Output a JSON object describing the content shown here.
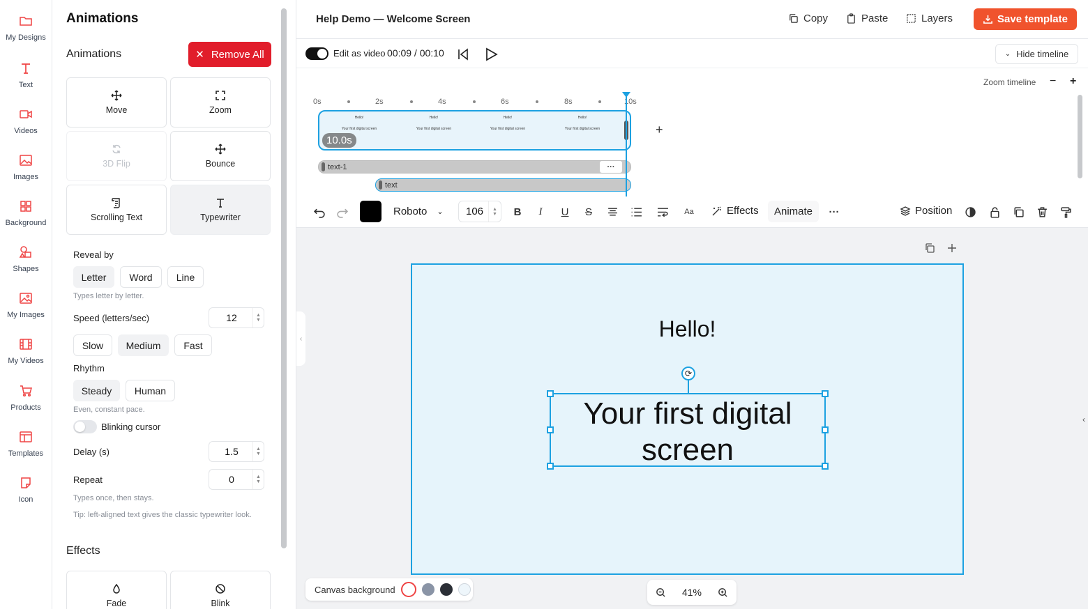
{
  "nav": [
    {
      "label": "My Designs",
      "icon": "folder-icon"
    },
    {
      "label": "Text",
      "icon": "text-icon"
    },
    {
      "label": "Videos",
      "icon": "video-icon"
    },
    {
      "label": "Images",
      "icon": "image-icon"
    },
    {
      "label": "Background",
      "icon": "grid-icon"
    },
    {
      "label": "Shapes",
      "icon": "shapes-icon"
    },
    {
      "label": "My Images",
      "icon": "my-images-icon"
    },
    {
      "label": "My Videos",
      "icon": "film-icon"
    },
    {
      "label": "Products",
      "icon": "cart-icon"
    },
    {
      "label": "Templates",
      "icon": "template-icon"
    },
    {
      "label": "Icon",
      "icon": "sticker-icon"
    }
  ],
  "panel": {
    "title": "Animations",
    "subtitle": "Animations",
    "remove_all": "Remove All",
    "cards": [
      {
        "label": "Move"
      },
      {
        "label": "Zoom"
      },
      {
        "label": "3D Flip"
      },
      {
        "label": "Bounce"
      },
      {
        "label": "Scrolling Text"
      },
      {
        "label": "Typewriter"
      }
    ],
    "reveal_label": "Reveal by",
    "reveal_options": [
      "Letter",
      "Word",
      "Line"
    ],
    "reveal_hint": "Types letter by letter.",
    "speed_label": "Speed (letters/sec)",
    "speed_value": "12",
    "speed_options": [
      "Slow",
      "Medium",
      "Fast"
    ],
    "rhythm_label": "Rhythm",
    "rhythm_options": [
      "Steady",
      "Human"
    ],
    "rhythm_hint": "Even, constant pace.",
    "blinking_label": "Blinking cursor",
    "delay_label": "Delay (s)",
    "delay_value": "1.5",
    "repeat_label": "Repeat",
    "repeat_value": "0",
    "repeat_hint": "Types once, then stays.",
    "tip": "Tip: left-aligned text gives the classic typewriter look.",
    "effects_title": "Effects",
    "effects": [
      {
        "label": "Fade"
      },
      {
        "label": "Blink"
      }
    ]
  },
  "header": {
    "title": "Help Demo — Welcome Screen",
    "copy": "Copy",
    "paste": "Paste",
    "layers": "Layers",
    "save": "Save template"
  },
  "timeline": {
    "edit_as_video": "Edit as video",
    "time": "00:09 / 00:10",
    "hide": "Hide timeline",
    "zoom_label": "Zoom timeline",
    "zoom_minus": "−",
    "zoom_plus": "+",
    "ticks": [
      "0s",
      "2s",
      "4s",
      "6s",
      "8s",
      "10s"
    ],
    "clip_duration": "10.0s",
    "mini_hello": "Hello!",
    "mini_text": "Your first digital screen",
    "add": "+",
    "tracks": [
      {
        "label": "text-1"
      },
      {
        "label": "text"
      }
    ],
    "more": "···"
  },
  "toolbar": {
    "font": "Roboto",
    "font_size": "106",
    "effects": "Effects",
    "animate": "Animate",
    "more": "···",
    "position": "Position",
    "text_color": "#000000"
  },
  "canvas": {
    "hello": "Hello!",
    "text": "Your first digital screen",
    "bg_label": "Canvas background",
    "bg_colors": [
      "#ffffff",
      "#8a94a6",
      "#2b2f36",
      "#eef6fb"
    ],
    "zoom": "41%"
  },
  "colors": {
    "accent": "#1da1e1",
    "danger": "#e11d2b",
    "brand": "#f0532d",
    "nav_icon": "#ef4444"
  }
}
